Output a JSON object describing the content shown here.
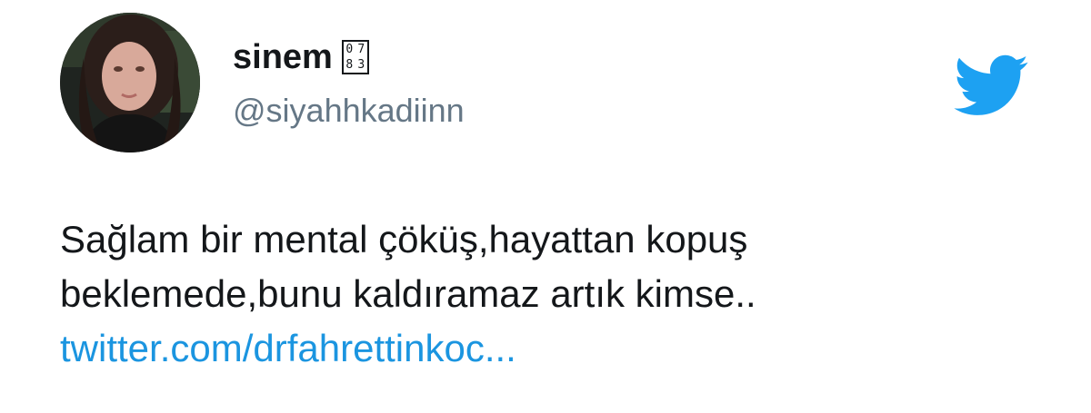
{
  "user": {
    "display_name": "sinem",
    "emoji_code": [
      "0",
      "7",
      "8",
      "3"
    ],
    "handle": "@siyahhkadiinn"
  },
  "tweet": {
    "line1": "Sağlam bir mental çöküş,hayattan kopuş",
    "line2": "beklemede,bunu kaldıramaz artık kimse..",
    "link_text": "twitter.com/drfahrettinkoc..."
  },
  "brand": {
    "logo_icon": "twitter-bird-icon",
    "logo_color": "#1da1f2",
    "link_color": "#1b95e0",
    "handle_color": "#657786"
  }
}
